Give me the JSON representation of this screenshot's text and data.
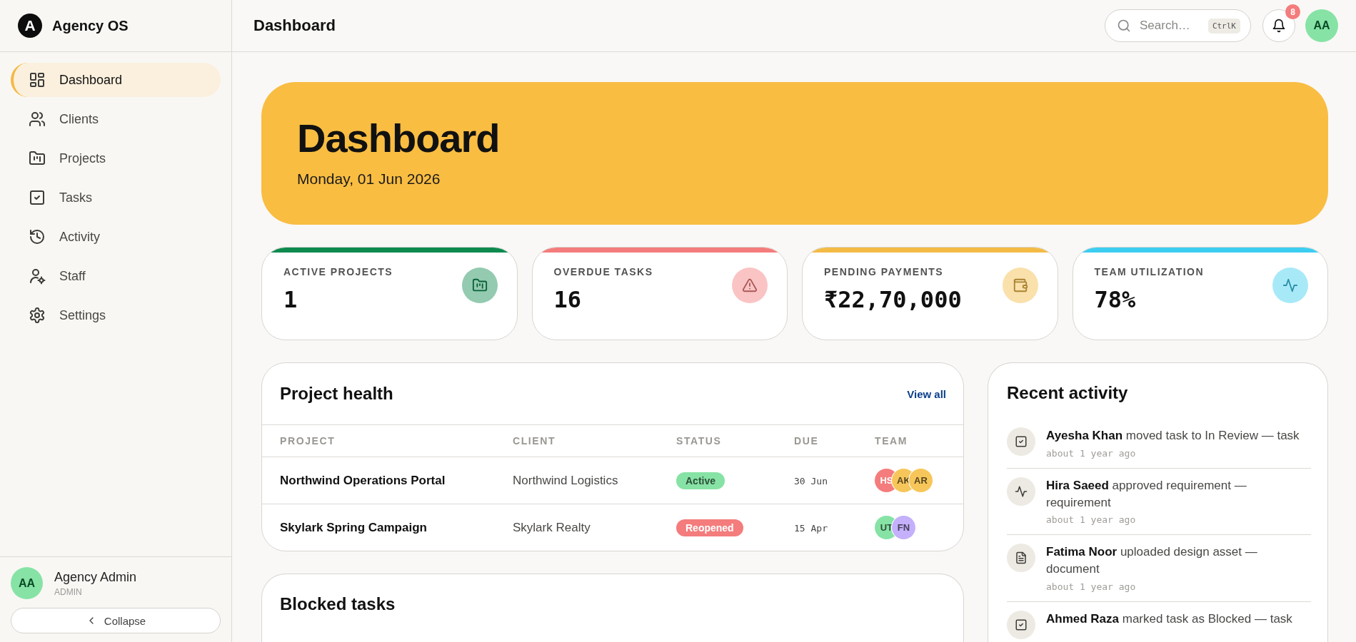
{
  "sidebar": {
    "brand": {
      "logo": "A",
      "name": "Agency OS"
    },
    "nav": [
      {
        "label": "Dashboard",
        "selected": true
      },
      {
        "label": "Clients",
        "selected": false
      },
      {
        "label": "Projects",
        "selected": false
      },
      {
        "label": "Tasks",
        "selected": false
      },
      {
        "label": "Activity",
        "selected": false
      },
      {
        "label": "Staff",
        "selected": false
      },
      {
        "label": "Settings",
        "selected": false
      }
    ],
    "user": {
      "avatar": "AA",
      "name": "Agency Admin",
      "role": "ADMIN"
    },
    "collapse": "Collapse"
  },
  "header": {
    "title": "Dashboard",
    "search": {
      "placeholder": "Search…",
      "shortcut": "CtrlK"
    },
    "notifications": "8",
    "avatar": "AA"
  },
  "hero": {
    "title": "Dashboard",
    "date": "Monday, 01 Jun 2026"
  },
  "stats": [
    {
      "label": "ACTIVE PROJECTS",
      "value": "1",
      "color": "#0e8a4f"
    },
    {
      "label": "OVERDUE TASKS",
      "value": "16",
      "color": "#f47c7c"
    },
    {
      "label": "PENDING PAYMENTS",
      "value": "₹22,70,000",
      "color": "#f3bb45"
    },
    {
      "label": "TEAM UTILIZATION",
      "value": "78%",
      "color": "#3dcdf0"
    }
  ],
  "project_health": {
    "title": "Project health",
    "link": "View all",
    "columns": [
      "PROJECT",
      "CLIENT",
      "STATUS",
      "DUE",
      "TEAM"
    ],
    "rows": [
      {
        "project": "Northwind Operations Portal",
        "client": "Northwind Logistics",
        "status": {
          "label": "Active",
          "color": "#86e3a5"
        },
        "due": "30 Jun",
        "team": [
          {
            "initials": "HS",
            "color": "#f47c7c"
          },
          {
            "initials": "AK",
            "color": "#f7c65a"
          },
          {
            "initials": "AR",
            "color": "#f7c65a"
          }
        ]
      },
      {
        "project": "Skylark Spring Campaign",
        "client": "Skylark Realty",
        "status": {
          "label": "Reopened",
          "color": "#f47c7c"
        },
        "due": "15 Apr",
        "team": [
          {
            "initials": "UT",
            "color": "#86e3a5"
          },
          {
            "initials": "FN",
            "color": "#c4b0fb"
          }
        ]
      }
    ]
  },
  "blocked_tasks": {
    "title": "Blocked tasks"
  },
  "recent_activity": {
    "title": "Recent activity",
    "items": [
      {
        "text": "**Ayesha Khan** moved task to In Review — task",
        "time": "about 1 year ago"
      },
      {
        "text": "**Hira Saeed** approved requirement — requirement",
        "time": "about 1 year ago"
      },
      {
        "text": "**Fatima Noor** uploaded design asset — document",
        "time": "about 1 year ago"
      },
      {
        "text": "**Ahmed Raza** marked task as Blocked — task"
      }
    ]
  }
}
